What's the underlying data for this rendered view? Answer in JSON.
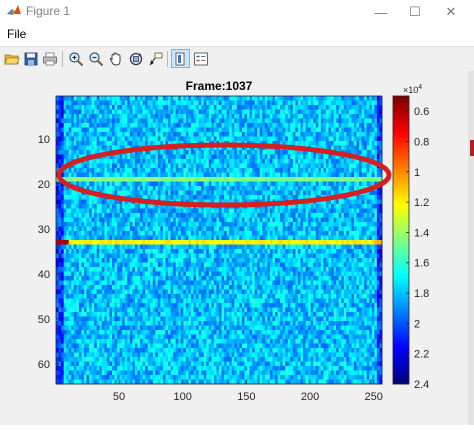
{
  "window": {
    "title": "Figure 1",
    "controls": {
      "minimize": "—",
      "maximize": "☐",
      "close": "✕"
    }
  },
  "menu": {
    "file": "File"
  },
  "toolbar": {
    "icons": [
      "open-icon",
      "save-icon",
      "print-icon",
      "zoom-in-icon",
      "zoom-out-icon",
      "pan-icon",
      "rotate-icon",
      "data-cursor-icon",
      "colorbar-icon",
      "legend-icon"
    ]
  },
  "plot": {
    "title": "Frame:1037",
    "y_ticks": [
      "10",
      "20",
      "30",
      "40",
      "50",
      "60"
    ],
    "x_ticks": [
      "50",
      "100",
      "150",
      "200",
      "250"
    ],
    "colorbar_ticks": [
      "2.4",
      "2.2",
      "2",
      "1.8",
      "1.6",
      "1.4",
      "1.2",
      "1",
      "0.8",
      "0.6"
    ],
    "colorbar_exponent": "×10",
    "colorbar_exponent_power": "4",
    "annotation_color": "#d42020"
  },
  "chart_data": {
    "type": "heatmap",
    "title": "Frame:1037",
    "x_range": [
      1,
      256
    ],
    "y_range": [
      1,
      64
    ],
    "y_reversed": true,
    "x_ticks": [
      50,
      100,
      150,
      200,
      250
    ],
    "y_ticks": [
      10,
      20,
      30,
      40,
      50,
      60
    ],
    "colormap": "jet",
    "clim": [
      6000,
      25000
    ],
    "colorbar_ticks": [
      0.6,
      0.8,
      1,
      1.2,
      1.4,
      1.6,
      1.8,
      2,
      2.2,
      2.4
    ],
    "colorbar_scale": "x10^4",
    "background_level": 12000,
    "features": [
      {
        "row": 19,
        "x": [
          1,
          256
        ],
        "level": 15500
      },
      {
        "row": 33,
        "x": [
          1,
          256
        ],
        "level": 18000
      },
      {
        "row": 33,
        "x": [
          1,
          10
        ],
        "level": 24000
      },
      {
        "row": 33,
        "x": [
          248,
          256
        ],
        "level": 19000
      }
    ],
    "annotation": {
      "shape": "ellipse",
      "around_row": 19,
      "color": "#d42020"
    }
  }
}
